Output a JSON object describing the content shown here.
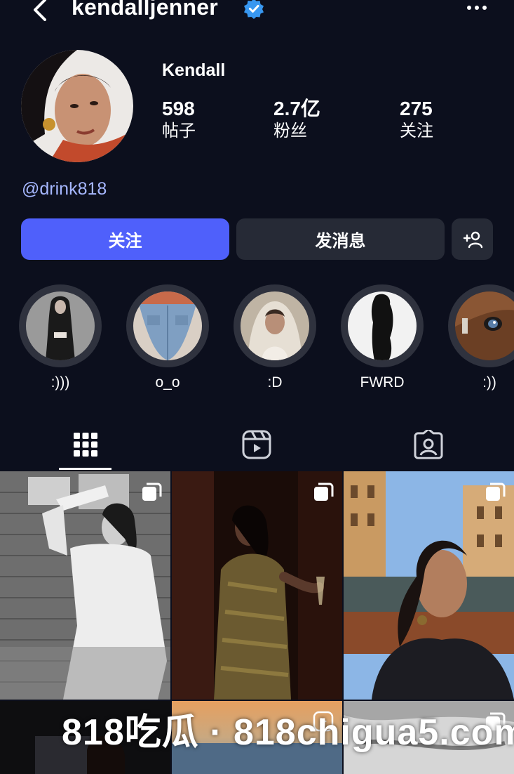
{
  "header": {
    "username": "kendalljenner",
    "verified": true,
    "back_icon": "chevron-left-icon",
    "more_icon": "more-horizontal-icon"
  },
  "profile": {
    "display_name": "Kendall",
    "bio_link": "@drink818",
    "stats": [
      {
        "value": "598",
        "label": "帖子"
      },
      {
        "value": "2.7亿",
        "label": "粉丝"
      },
      {
        "value": "275",
        "label": "关注"
      }
    ]
  },
  "actions": {
    "follow_label": "关注",
    "message_label": "发消息",
    "add_icon": "add-person-icon"
  },
  "highlights": [
    {
      "label": ":)))"
    },
    {
      "label": "o_o"
    },
    {
      "label": ":D"
    },
    {
      "label": "FWRD"
    },
    {
      "label": ":))"
    }
  ],
  "tabs": [
    {
      "name": "posts",
      "icon": "grid-icon",
      "active": true
    },
    {
      "name": "reels",
      "icon": "reels-icon",
      "active": false
    },
    {
      "name": "tagged",
      "icon": "tagged-icon",
      "active": false
    }
  ],
  "watermark": "818吃瓜 · 818chigua5.com",
  "colors": {
    "background": "#0c0f1d",
    "follow_button": "#4f60fb",
    "secondary_button": "#262a36",
    "link": "#a6b7ff",
    "verified_badge": "#3897f0"
  }
}
